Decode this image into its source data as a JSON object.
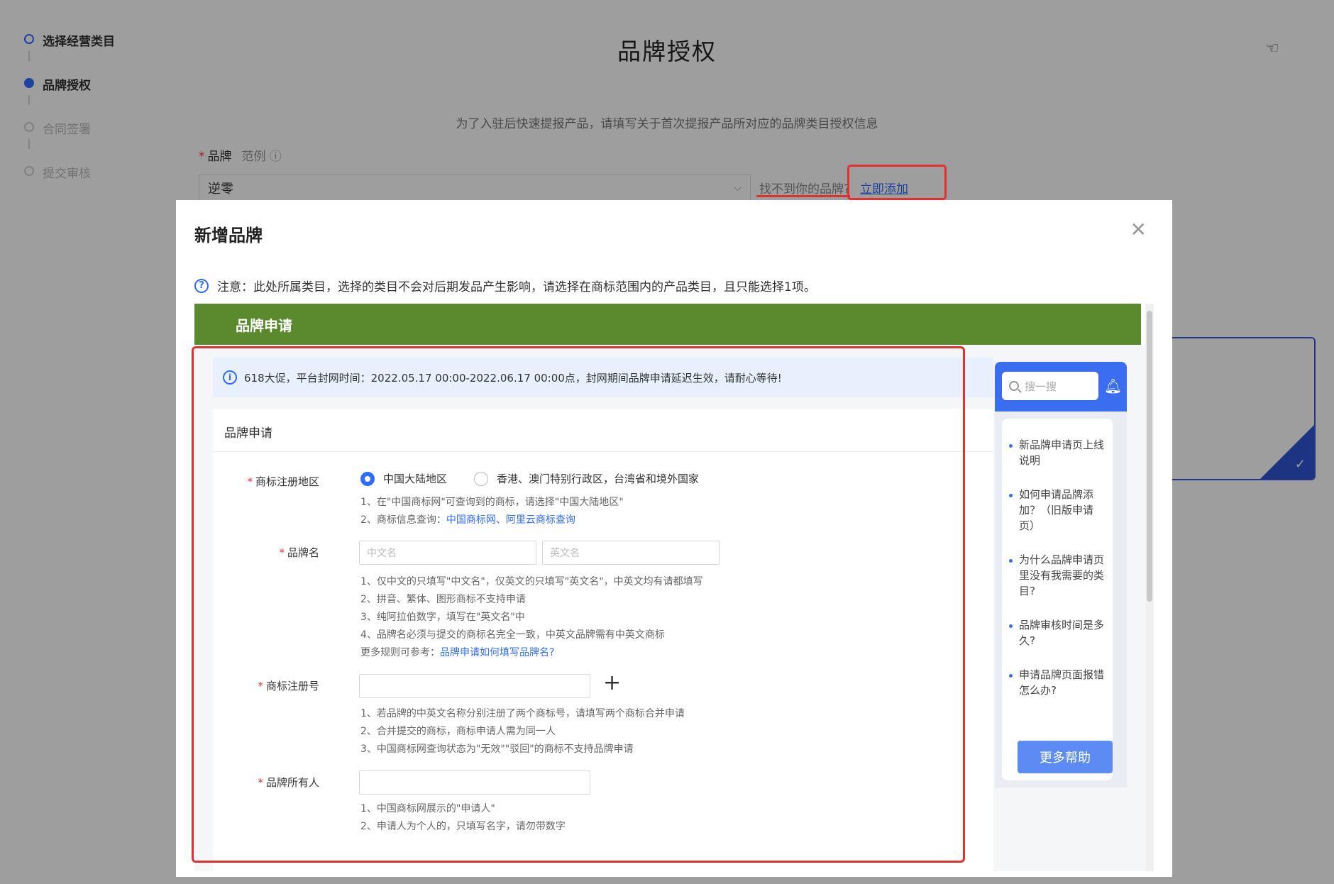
{
  "steps": [
    {
      "label": "选择经营类目"
    },
    {
      "label": "品牌授权"
    },
    {
      "label": "合同签署"
    },
    {
      "label": "提交审核"
    }
  ],
  "page": {
    "title": "品牌授权",
    "subtitle": "为了入驻后快速提报产品，请填写关于首次提报产品所对应的品牌类目授权信息",
    "brand_label": "品牌",
    "example_label": "范例",
    "brand_value": "逆零",
    "not_found_text": "找不到你的品牌?",
    "add_now_link": "立即添加"
  },
  "modal": {
    "title": "新增品牌",
    "notice": "注意：此处所属类目，选择的类目不会对后期发品产生影响，请选择在商标范围内的产品类目，且只能选择1项。",
    "green_bar_title": "品牌申请",
    "info_banner": "618大促，平台封网时间：2022.05.17 00:00-2022.06.17 00:00点，封网期间品牌申请延迟生效，请耐心等待!",
    "form_title": "品牌申请",
    "region": {
      "label": "商标注册地区",
      "option_mainland": "中国大陆地区",
      "option_overseas": "香港、澳门特别行政区，台湾省和境外国家",
      "hint1": "1、在\"中国商标网\"可查询到的商标，请选择\"中国大陆地区\"",
      "hint2_prefix": "2、商标信息查询：",
      "hint2_link": "中国商标网、阿里云商标查询"
    },
    "brand_name": {
      "label": "品牌名",
      "cn_placeholder": "中文名",
      "en_placeholder": "英文名",
      "hint1": "1、仅中文的只填写\"中文名\"，仅英文的只填写\"英文名\"，中英文均有请都填写",
      "hint2": "2、拼音、繁体、图形商标不支持申请",
      "hint3": "3、纯阿拉伯数字，填写在\"英文名\"中",
      "hint4": "4、品牌名必须与提交的商标名完全一致，中英文品牌需有中英文商标",
      "more_prefix": "更多规则可参考：",
      "more_link": "品牌申请如何填写品牌名?"
    },
    "reg_no": {
      "label": "商标注册号",
      "hint1": "1、若品牌的中英文名称分别注册了两个商标号，请填写两个商标合并申请",
      "hint2": "2、合并提交的商标，商标申请人需为同一人",
      "hint3": "3、中国商标网查询状态为\"无效\"\"驳回\"的商标不支持品牌申请"
    },
    "owner": {
      "label": "品牌所有人",
      "hint1": "1、中国商标网展示的\"申请人\"",
      "hint2": "2、申请人为个人的，只填写名字，请勿带数字"
    },
    "help": {
      "search_placeholder": "搜一搜",
      "items": [
        "新品牌申请页上线说明",
        "如何申请品牌添加？（旧版申请页）",
        "为什么品牌申请页里没有我需要的类目?",
        "品牌审核时间是多久?",
        "申请品牌页面报错怎么办?"
      ],
      "more_button": "更多帮助"
    }
  },
  "colors": {
    "accent": "#2f6bff",
    "green_bar": "#5b8a2e",
    "highlight_red": "#e03030"
  }
}
